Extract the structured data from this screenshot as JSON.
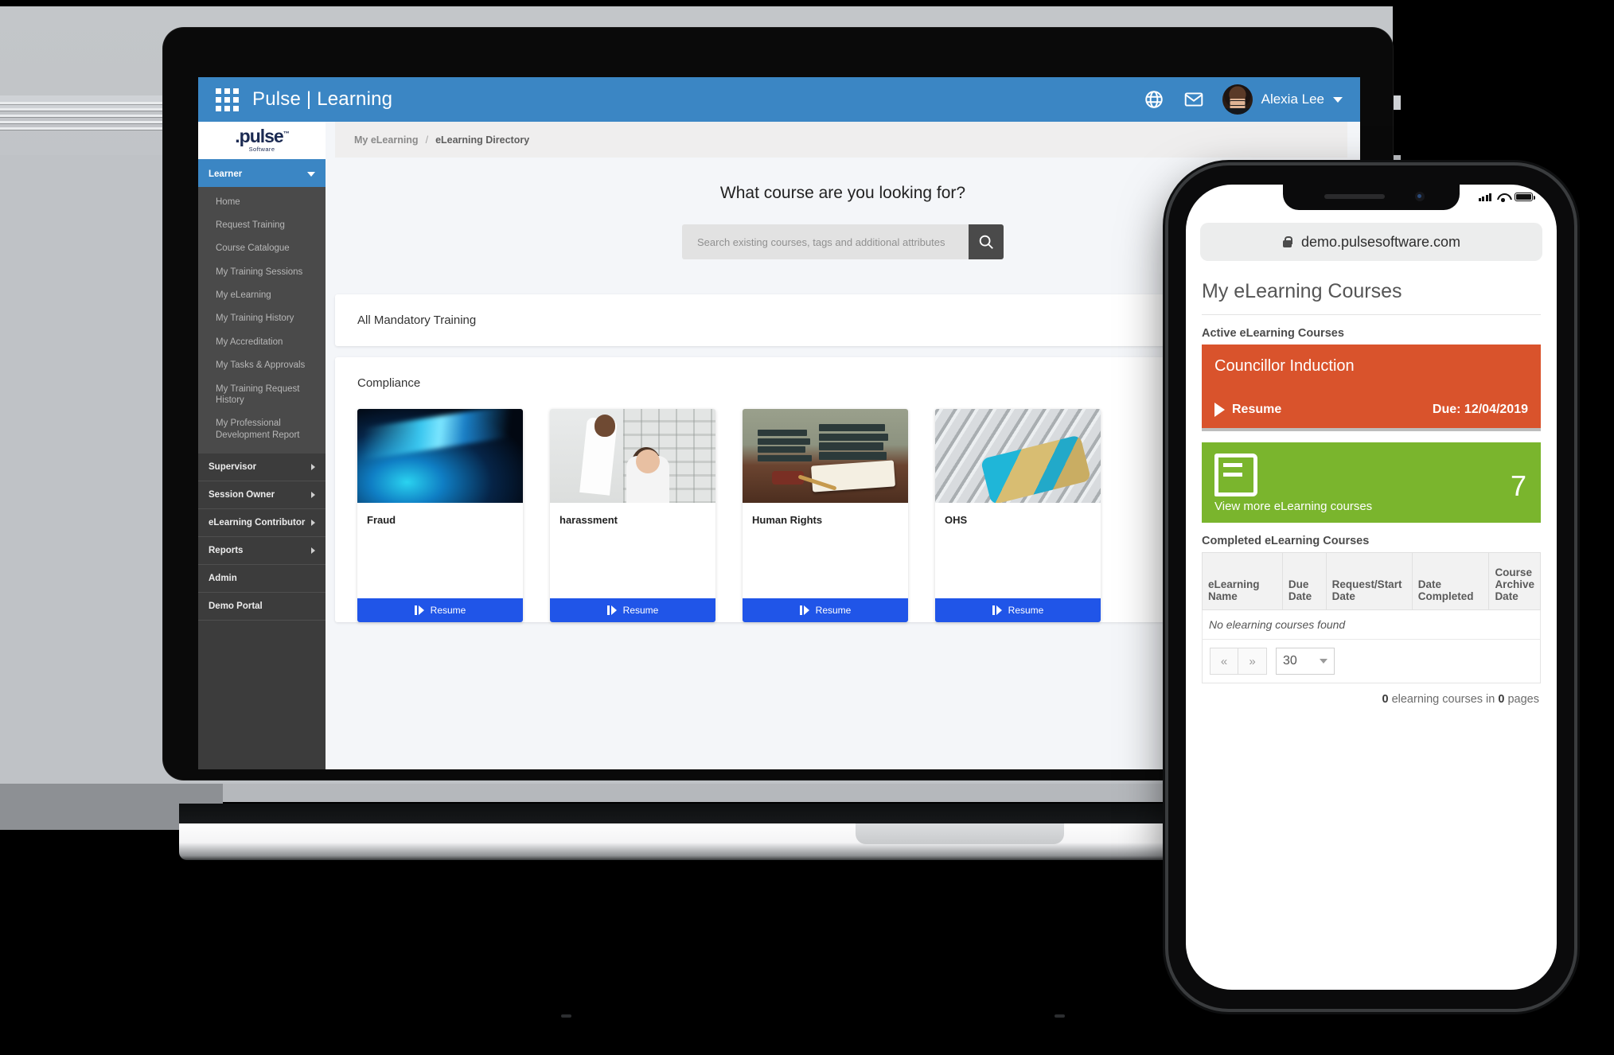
{
  "desktop": {
    "appbar": {
      "waffle_icon": "grid-apps-icon",
      "title": "Pulse | Learning",
      "globe_icon": "globe-icon",
      "mail_icon": "mail-icon",
      "user_name": "Alexia Lee",
      "caret_icon": "chevron-down-icon"
    },
    "brand": {
      "logo": ".pulse",
      "trademark": "™",
      "sub": "Software"
    },
    "sidebar": {
      "active_group": "Learner",
      "sub_items": [
        "Home",
        "Request Training",
        "Course Catalogue",
        "My Training Sessions",
        "My eLearning",
        "My Training History",
        "My Accreditation",
        "My Tasks & Approvals",
        "My Training Request History",
        "My Professional Development Report"
      ],
      "groups": [
        {
          "label": "Supervisor",
          "has_arrow": true
        },
        {
          "label": "Session Owner",
          "has_arrow": true
        },
        {
          "label": "eLearning Contributor",
          "has_arrow": true
        },
        {
          "label": "Reports",
          "has_arrow": true
        },
        {
          "label": "Admin",
          "has_arrow": false
        },
        {
          "label": "Demo Portal",
          "has_arrow": false
        }
      ]
    },
    "breadcrumb": {
      "parent": "My eLearning",
      "separator": "/",
      "current": "eLearning Directory"
    },
    "search": {
      "heading": "What course are you looking for?",
      "placeholder": "Search existing courses, tags and additional attributes",
      "value": "",
      "button_icon": "search-icon"
    },
    "panels": [
      {
        "title": "All Mandatory Training"
      },
      {
        "title": "Compliance"
      }
    ],
    "cards": [
      {
        "name": "Fraud",
        "cta": "Resume",
        "art": "art-fraud"
      },
      {
        "name": "harassment",
        "cta": "Resume",
        "art": "art-harass"
      },
      {
        "name": "Human Rights",
        "cta": "Resume",
        "art": "art-law"
      },
      {
        "name": "OHS",
        "cta": "Resume",
        "art": "art-ohs"
      }
    ]
  },
  "phone": {
    "status": {
      "signal_icon": "signal-bars-icon",
      "wifi_icon": "wifi-icon",
      "battery_icon": "battery-icon"
    },
    "url_bar": {
      "lock_icon": "lock-icon",
      "url": "demo.pulsesoftware.com"
    },
    "page_title": "My eLearning Courses",
    "active_heading": "Active eLearning Courses",
    "active_tile": {
      "title": "Councillor Induction",
      "resume_label": "Resume",
      "due_label": "Due: 12/04/2019",
      "color": "#d9532c",
      "play_icon": "play-icon"
    },
    "more_tile": {
      "book_icon": "book-icon",
      "count": "7",
      "link_label": "View more eLearning courses",
      "color": "#7ab52d"
    },
    "completed_heading": "Completed eLearning Courses",
    "table": {
      "headers": [
        "eLearning Name",
        "Due Date",
        "Request/Start Date",
        "Date Completed",
        "Course Archive Date"
      ],
      "empty_message": "No elearning courses found"
    },
    "pager": {
      "first_label": "«",
      "prev_label": "»",
      "page_size": "30",
      "caret_icon": "chevron-down-icon",
      "summary_count": "0",
      "summary_mid": " elearning courses in ",
      "summary_pages": "0",
      "summary_tail": " pages"
    }
  }
}
